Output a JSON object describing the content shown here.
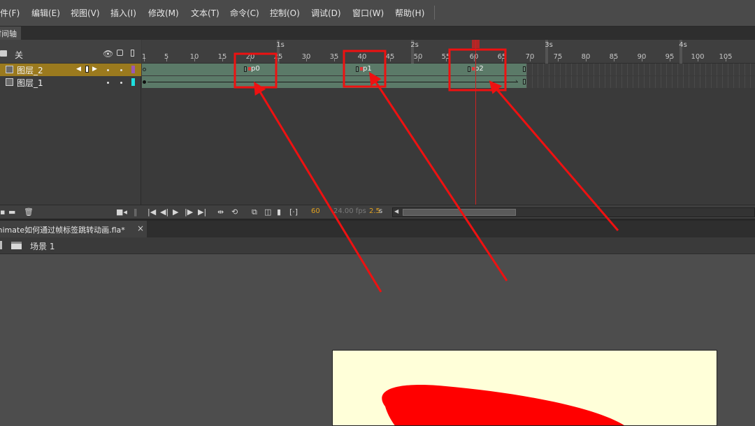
{
  "menu": {
    "items": [
      {
        "label": "文件(F)"
      },
      {
        "label": "编辑(E)"
      },
      {
        "label": "视图(V)"
      },
      {
        "label": "插入(I)"
      },
      {
        "label": "修改(M)"
      },
      {
        "label": "文本(T)"
      },
      {
        "label": "命令(C)"
      },
      {
        "label": "控制(O)"
      },
      {
        "label": "调试(D)"
      },
      {
        "label": "窗口(W)"
      },
      {
        "label": "帮助(H)"
      }
    ]
  },
  "timeline": {
    "panel_tab": "时间轴",
    "header_label": "关",
    "seconds": [
      "1s",
      "2s",
      "3s",
      "4s"
    ],
    "frame_numbers": [
      "1",
      "5",
      "10",
      "15",
      "20",
      "25",
      "30",
      "35",
      "40",
      "45",
      "50",
      "55",
      "60",
      "65",
      "70",
      "75",
      "80",
      "85",
      "90",
      "95",
      "100",
      "105"
    ],
    "layers": [
      {
        "name": "图层_2",
        "selected": true,
        "color": "#9b59b6"
      },
      {
        "name": "图层_1",
        "selected": false,
        "color": "#1ee0e0"
      }
    ],
    "frame_labels": [
      "p0",
      "p1",
      "p2"
    ],
    "current_frame": "60",
    "fps": "24.00 fps",
    "elapsed": "2.5",
    "elapsed_unit": "s"
  },
  "document": {
    "tab_title": "Animate如何通过帧标签跳转动画.fla*",
    "close_symbol": "×",
    "scene_label": "场景 1"
  },
  "colors": {
    "accent": "#e0a020",
    "playhead": "#cc2222",
    "annotation": "#ee1111",
    "stage_bg": "#ffffd9",
    "shape": "#ff0000"
  }
}
